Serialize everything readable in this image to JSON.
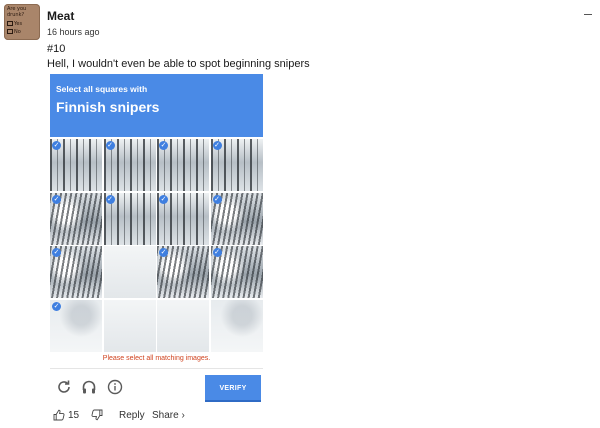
{
  "comment": {
    "avatar_lines": [
      "Are you",
      "drunk?",
      "Yes",
      "No"
    ],
    "username": "Meat",
    "timestamp": "16 hours ago",
    "post_number": "#10",
    "text": "Hell, I wouldn't even be able to spot beginning snipers"
  },
  "captcha": {
    "instruction": "Select all squares with",
    "target": "Finnish snipers",
    "warning": "Please select all matching images.",
    "verify_label": "VERIFY",
    "tiles": [
      {
        "kind": "tree",
        "checked": true
      },
      {
        "kind": "tree",
        "checked": true
      },
      {
        "kind": "tree",
        "checked": true
      },
      {
        "kind": "tree",
        "checked": true
      },
      {
        "kind": "tree dense",
        "checked": true
      },
      {
        "kind": "tree",
        "checked": true
      },
      {
        "kind": "tree",
        "checked": true
      },
      {
        "kind": "tree dense",
        "checked": true
      },
      {
        "kind": "tree dense",
        "checked": true
      },
      {
        "kind": "road",
        "checked": false
      },
      {
        "kind": "tree dense",
        "checked": true
      },
      {
        "kind": "tree dense",
        "checked": true
      },
      {
        "kind": "snow",
        "checked": true
      },
      {
        "kind": "road",
        "checked": false
      },
      {
        "kind": "road",
        "checked": false
      },
      {
        "kind": "snow",
        "checked": false
      }
    ],
    "icons": [
      "refresh-icon",
      "headphones-icon",
      "info-icon"
    ]
  },
  "actions": {
    "like_count": "15",
    "reply_label": "Reply",
    "share_label": "Share ›"
  },
  "colors": {
    "captcha_blue": "#4a8ae6",
    "warning_red": "#d0431f"
  }
}
